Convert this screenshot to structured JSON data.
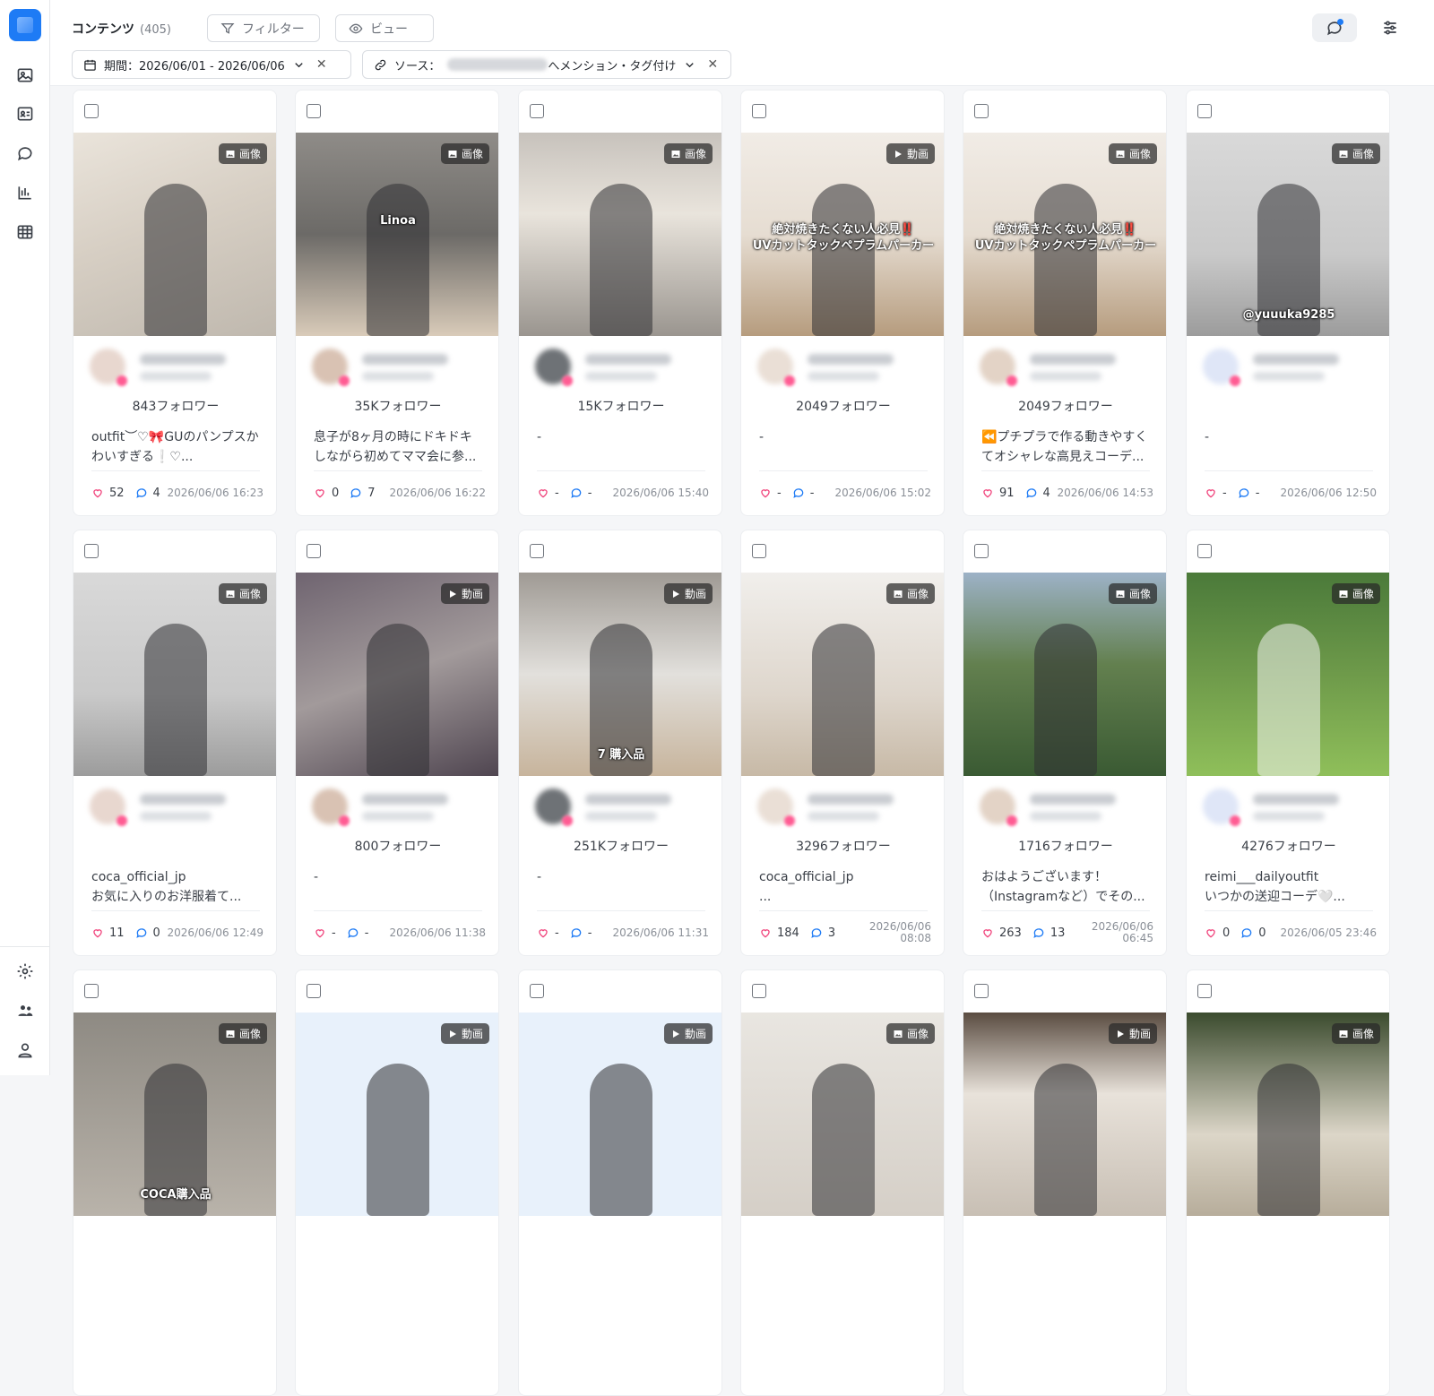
{
  "header": {
    "title": "コンテンツ",
    "count": "(405)",
    "filter_label": "フィルター",
    "view_label": "ビュー"
  },
  "chips": {
    "period": "期間：2026/06/01 - 2026/06/06",
    "source_prefix": "ソース：",
    "source_suffix": "へメンション・タグ付け"
  },
  "sidebar": {
    "top_icons": [
      "image-icon",
      "profile-card-icon",
      "chat-icon",
      "bar-chart-icon",
      "table-icon"
    ],
    "bottom_icons": [
      "settings-icon",
      "users-icon",
      "user-icon"
    ]
  },
  "colors": {
    "accent": "#1e7bf5",
    "like": "#f0417a"
  },
  "cards": [
    {
      "type": "画像",
      "kind": "image",
      "followers": "843フォロワー",
      "caption": "outfit︶♡🎀GUのパンプスか\nわいすぎる❕♡...",
      "likes": "52",
      "comments": "4",
      "date": "2026/06/06 16:23",
      "media": "m-beige",
      "overlay": ""
    },
    {
      "type": "画像",
      "kind": "image",
      "followers": "35Kフォロワー",
      "caption": "息子が8ヶ月の時にドキドキ\nしながら初めてママ会に参...",
      "likes": "0",
      "comments": "7",
      "date": "2026/06/06 16:22",
      "media": "m-office",
      "overlay": "Linoa"
    },
    {
      "type": "画像",
      "kind": "image",
      "followers": "15Kフォロワー",
      "caption": "-",
      "likes": "-",
      "comments": "-",
      "date": "2026/06/06 15:40",
      "media": "m-white",
      "overlay": ""
    },
    {
      "type": "動画",
      "kind": "video",
      "followers": "2049フォロワー",
      "caption": "-",
      "likes": "-",
      "comments": "-",
      "date": "2026/06/06 15:02",
      "media": "m-room",
      "overlay": "絶対焼きたくない人必見‼️\nUVカットタックペプラムパーカー"
    },
    {
      "type": "画像",
      "kind": "image",
      "followers": "2049フォロワー",
      "caption": "⏪プチプラで作る動きやすく\nてオシャレな高見えコーデ...",
      "likes": "91",
      "comments": "4",
      "date": "2026/06/06 14:53",
      "media": "m-room",
      "overlay": "絶対焼きたくない人必見‼️\nUVカットタックペプラムパーカー"
    },
    {
      "type": "画像",
      "kind": "image",
      "followers": "",
      "caption": "-",
      "likes": "-",
      "comments": "-",
      "date": "2026/06/06 12:50",
      "media": "m-gray",
      "overlay": "@yuuuka9285"
    },
    {
      "type": "画像",
      "kind": "image",
      "followers": "",
      "caption": "coca_official_jp\nお気に入りのお洋服着て...",
      "likes": "11",
      "comments": "0",
      "date": "2026/06/06 12:49",
      "media": "m-gray",
      "overlay": ""
    },
    {
      "type": "動画",
      "kind": "video",
      "followers": "800フォロワー",
      "caption": "-",
      "likes": "-",
      "comments": "-",
      "date": "2026/06/06 11:38",
      "media": "m-dots",
      "overlay": ""
    },
    {
      "type": "動画",
      "kind": "video",
      "followers": "251Kフォロワー",
      "caption": "-",
      "likes": "-",
      "comments": "-",
      "date": "2026/06/06 11:31",
      "media": "m-bag",
      "overlay": "7 購入品"
    },
    {
      "type": "画像",
      "kind": "image",
      "followers": "3296フォロワー",
      "caption": "coca_official_jp\n...",
      "likes": "184",
      "comments": "3",
      "date": "2026/06/06\n08:08",
      "media": "m-lace",
      "overlay": ""
    },
    {
      "type": "画像",
      "kind": "image",
      "followers": "1716フォロワー",
      "caption": "おはようございます！\n（Instagramなど）でその...",
      "likes": "263",
      "comments": "13",
      "date": "2026/06/06\n06:45",
      "media": "m-garden",
      "overlay": ""
    },
    {
      "type": "画像",
      "kind": "image",
      "followers": "4276フォロワー",
      "caption": "reimi___dailyoutfit\nいつかの送迎コーデ🤍...",
      "likes": "0",
      "comments": "0",
      "date": "2026/06/05 23:46",
      "media": "m-park",
      "overlay": ""
    },
    {
      "type": "画像",
      "kind": "image",
      "followers": "",
      "caption": "",
      "likes": "",
      "comments": "",
      "date": "",
      "media": "m-shoe",
      "overlay": "COCA購入品"
    },
    {
      "type": "動画",
      "kind": "video",
      "followers": "",
      "caption": "",
      "likes": "",
      "comments": "",
      "date": "",
      "media": "m-light",
      "overlay": ""
    },
    {
      "type": "動画",
      "kind": "video",
      "followers": "",
      "caption": "",
      "likes": "",
      "comments": "",
      "date": "",
      "media": "m-light",
      "overlay": ""
    },
    {
      "type": "画像",
      "kind": "image",
      "followers": "",
      "caption": "",
      "likes": "",
      "comments": "",
      "date": "",
      "media": "m-white2",
      "overlay": ""
    },
    {
      "type": "動画",
      "kind": "video",
      "followers": "",
      "caption": "",
      "likes": "",
      "comments": "",
      "date": "",
      "media": "m-knit",
      "overlay": ""
    },
    {
      "type": "画像",
      "kind": "image",
      "followers": "",
      "caption": "",
      "likes": "",
      "comments": "",
      "date": "",
      "media": "m-ruffle",
      "overlay": ""
    }
  ]
}
